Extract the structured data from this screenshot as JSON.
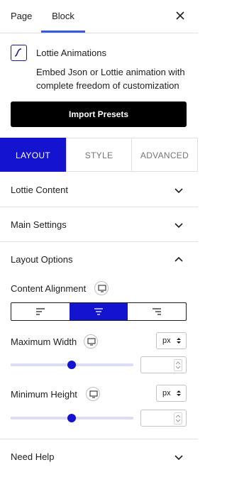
{
  "top_tabs": {
    "page": "Page",
    "block": "Block"
  },
  "block": {
    "title": "Lottie Animations",
    "description": "Embed Json or Lottie animation with complete freedom of customization",
    "import_label": "Import Presets"
  },
  "style_tabs": {
    "layout": "LAYOUT",
    "style": "STYLE",
    "advanced": "ADVANCED"
  },
  "panels": {
    "lottie_content": "Lottie Content",
    "main_settings": "Main Settings",
    "layout_options": "Layout Options",
    "need_help": "Need Help"
  },
  "layout_options": {
    "content_alignment": "Content Alignment",
    "alignment_selected": "center",
    "maximum_width": {
      "label": "Maximum Width",
      "unit": "px",
      "value": "",
      "slider_fraction": 0.5
    },
    "minimum_height": {
      "label": "Minimum Height",
      "unit": "px",
      "value": "",
      "slider_fraction": 0.5
    }
  },
  "colors": {
    "accent": "#1413d0",
    "tab_underline": "#3858e9",
    "button_dark": "#000000"
  },
  "icons": [
    "close-icon",
    "lottie-block-icon",
    "chevron-down-icon",
    "chevron-up-icon",
    "desktop-icon",
    "align-left-icon",
    "align-center-icon",
    "align-right-icon",
    "unit-arrows-icon",
    "spinner-arrows-icon"
  ]
}
